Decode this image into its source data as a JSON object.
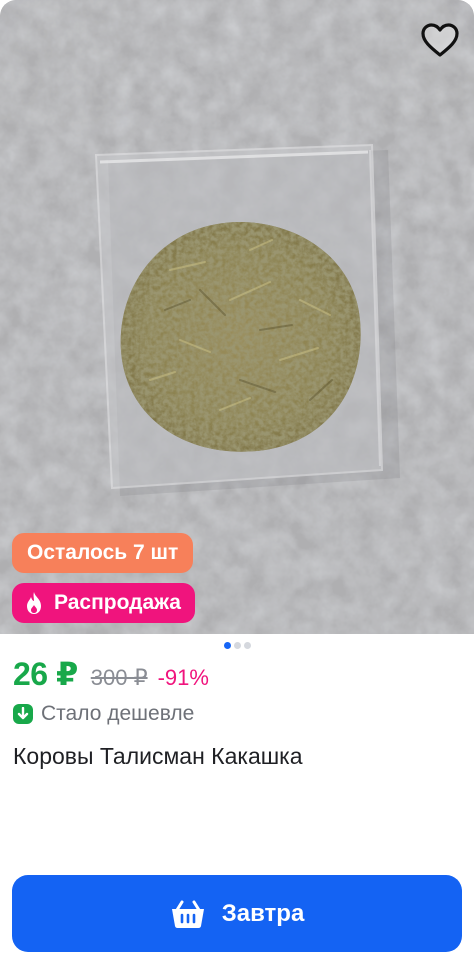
{
  "product": {
    "badges": {
      "stock": "Осталось 7 шт",
      "sale": "Распродажа"
    },
    "gallery": {
      "slide_count": 3,
      "active_slide": 1
    },
    "price": {
      "current": "26 ₽",
      "old": "300 ₽",
      "discount": "-91%"
    },
    "price_note": "Стало дешевле",
    "title": "Коровы Талисман Какашка",
    "buy_button_label": "Завтра"
  },
  "icons": {
    "favorite": "heart-outline-icon",
    "sale": "flame-icon",
    "price_down": "arrow-down-icon",
    "cart": "basket-icon"
  },
  "colors": {
    "price_green": "#18a84a",
    "discount_pink": "#f0147d",
    "stock_badge": "#f7805a",
    "accent_blue": "#1463f3"
  }
}
